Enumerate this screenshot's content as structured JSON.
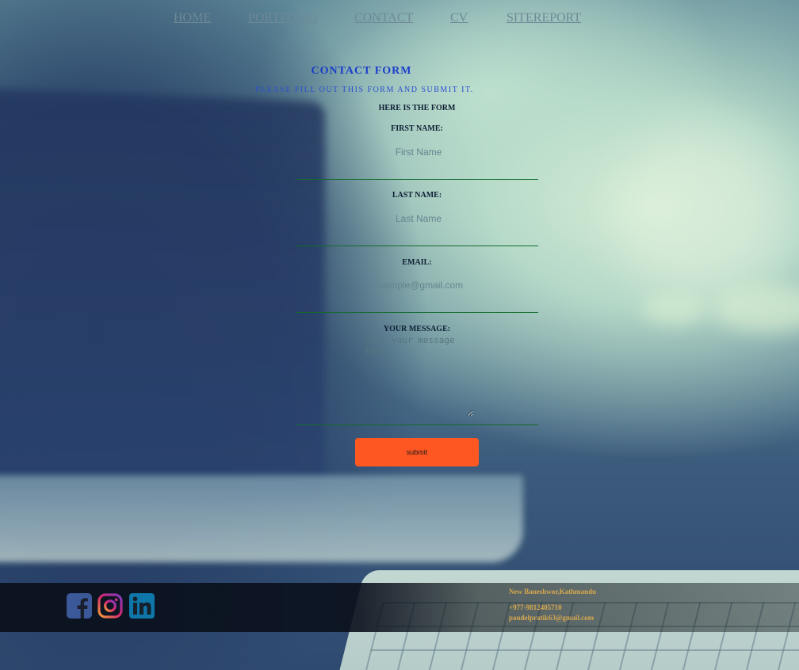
{
  "nav": {
    "items": [
      {
        "label": "HOME"
      },
      {
        "label": "PORTFOLIO"
      },
      {
        "label": "CONTACT"
      },
      {
        "label": "CV"
      },
      {
        "label": "SITEREPORT"
      }
    ]
  },
  "form": {
    "title": "CONTACT FORM",
    "subtitle": "PLEASE FILL OUT THIS FORM AND SUBMIT IT.",
    "intro": "HERE IS THE FORM",
    "first_name": {
      "label": "FIRST NAME:",
      "placeholder": "First Name",
      "value": ""
    },
    "last_name": {
      "label": "LAST NAME:",
      "placeholder": "Last Name",
      "value": ""
    },
    "email": {
      "label": "EMAIL:",
      "placeholder": "example@gmail.com",
      "value": ""
    },
    "message": {
      "label": "YOUR MESSAGE:",
      "placeholder": "Text your message here",
      "value": ""
    },
    "submit_label": "submit"
  },
  "footer": {
    "social": [
      {
        "icon": "facebook-icon",
        "color": "#3b5998"
      },
      {
        "icon": "instagram-icon",
        "color": "#c13584"
      },
      {
        "icon": "linkedin-icon",
        "color": "#0e76a8"
      }
    ],
    "address": "New Baneshwor,Kathmandu",
    "phone": "+977-9812405710",
    "email": "paudelpratik63@gmail.com"
  },
  "colors": {
    "accent_button": "#ff5722",
    "form_title": "#1a3dc9",
    "footer_text": "#d6a84e",
    "underline": "#136b2c"
  }
}
